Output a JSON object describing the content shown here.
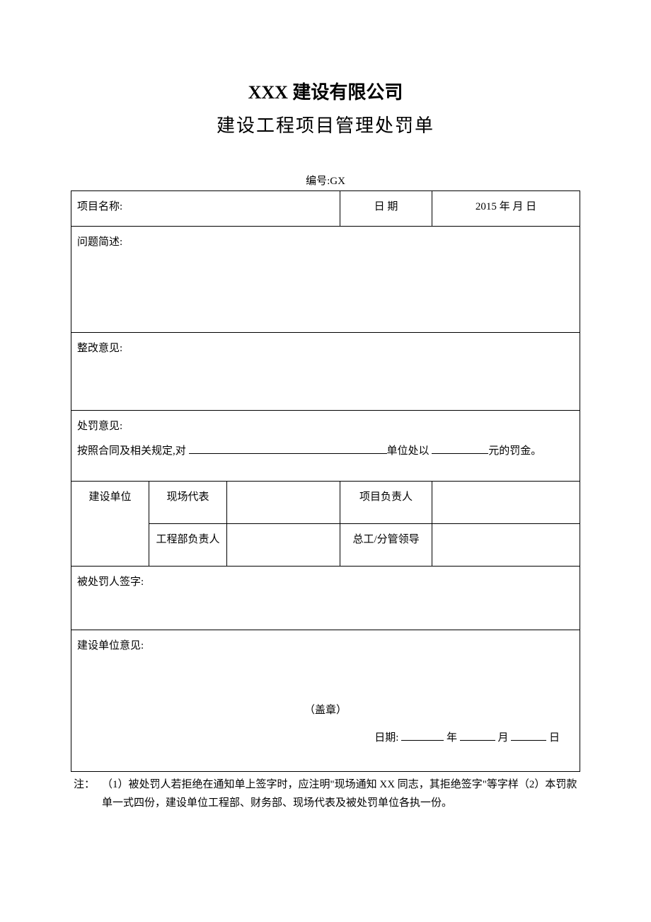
{
  "header": {
    "company": "XXX 建设有限公司",
    "doc_title": "建设工程项目管理处罚单",
    "serial_label": "编号:GX"
  },
  "row1": {
    "project_name_label": "项目名称:",
    "date_label": "日 期",
    "date_value": "2015 年 月 日"
  },
  "sections": {
    "problem_label": "问题简述:",
    "rectify_label": "整改意见:",
    "penalty_label": "处罚意见:",
    "penalty_text_1": "按照合同及相关规定,对 ",
    "penalty_text_2": "单位处以 ",
    "penalty_text_3": "元的罚金。",
    "penalized_sign_label": "被处罚人签字:",
    "dev_opinion_label": "建设单位意见:",
    "stamp_text": "（盖章）",
    "date_prefix": "日期:",
    "year_suffix": "年",
    "month_suffix": "月",
    "day_suffix": "日"
  },
  "sig_grid": {
    "dev_unit": "建设单位",
    "site_rep": "现场代表",
    "proj_lead": "项目负责人",
    "eng_lead": "工程部负责人",
    "chief_lead": "总工/分管领导"
  },
  "footnote": {
    "prefix": "注：",
    "body": "（1）被处罚人若拒绝在通知单上签字时，应注明\"现场通知 XX 同志，其拒绝签字\"等字样（2）本罚款单一式四份，建设单位工程部、财务部、现场代表及被处罚单位各执一份。"
  }
}
